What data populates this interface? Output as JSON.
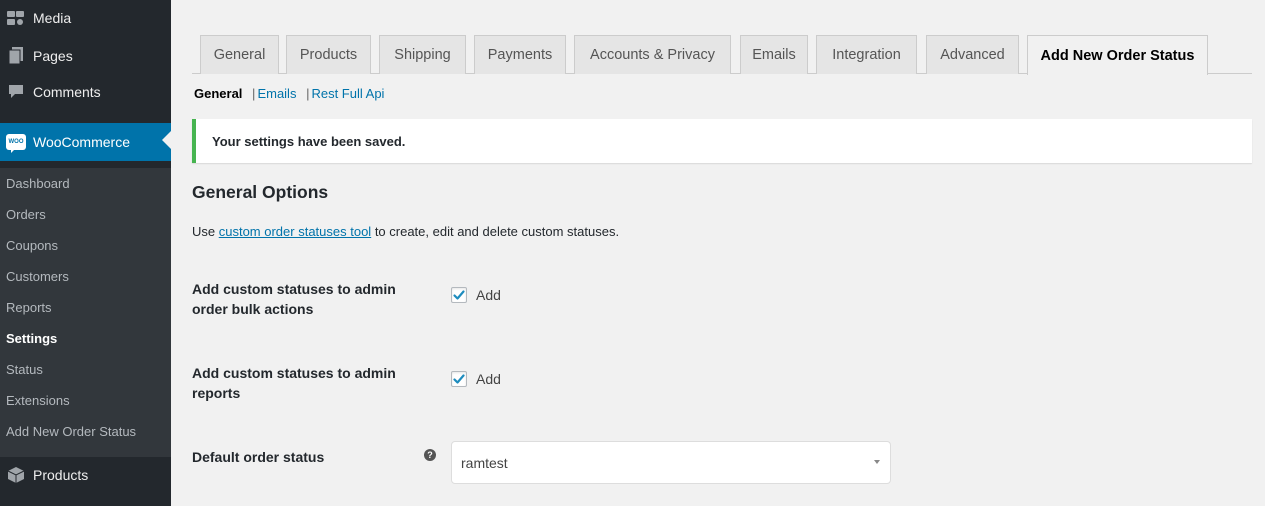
{
  "sidebar": {
    "menu": [
      {
        "label": "Media",
        "icon": "media-icon"
      },
      {
        "label": "Pages",
        "icon": "pages-icon"
      },
      {
        "label": "Comments",
        "icon": "comments-icon"
      },
      {
        "label": "WooCommerce",
        "icon": "woocommerce-icon",
        "badge": "WOO"
      },
      {
        "label": "Products",
        "icon": "products-icon"
      }
    ],
    "submenu": [
      "Dashboard",
      "Orders",
      "Coupons",
      "Customers",
      "Reports",
      "Settings",
      "Status",
      "Extensions",
      "Add New Order Status"
    ],
    "current_submenu": "Settings"
  },
  "tabs": [
    "General",
    "Products",
    "Shipping",
    "Payments",
    "Accounts & Privacy",
    "Emails",
    "Integration",
    "Advanced",
    "Add New Order Status"
  ],
  "active_tab": "Add New Order Status",
  "sections": {
    "current": "General",
    "separator": "|",
    "links": [
      "Emails",
      "Rest Full Api"
    ]
  },
  "notice": "Your settings have been saved.",
  "heading": "General Options",
  "description": {
    "before": "Use ",
    "link": "custom order statuses tool",
    "after": " to create, edit and delete custom statuses."
  },
  "fields": {
    "bulk_actions": {
      "label": "Add custom statuses to admin order bulk actions",
      "checkbox_label": "Add",
      "checked": true
    },
    "reports": {
      "label": "Add custom statuses to admin reports",
      "checkbox_label": "Add",
      "checked": true
    },
    "default_status": {
      "label": "Default order status",
      "help": "?",
      "value": "ramtest"
    }
  },
  "colors": {
    "sidebar_bg": "#23282d",
    "submenu_bg": "#32373c",
    "accent": "#0073aa",
    "notice_success": "#46b450"
  }
}
